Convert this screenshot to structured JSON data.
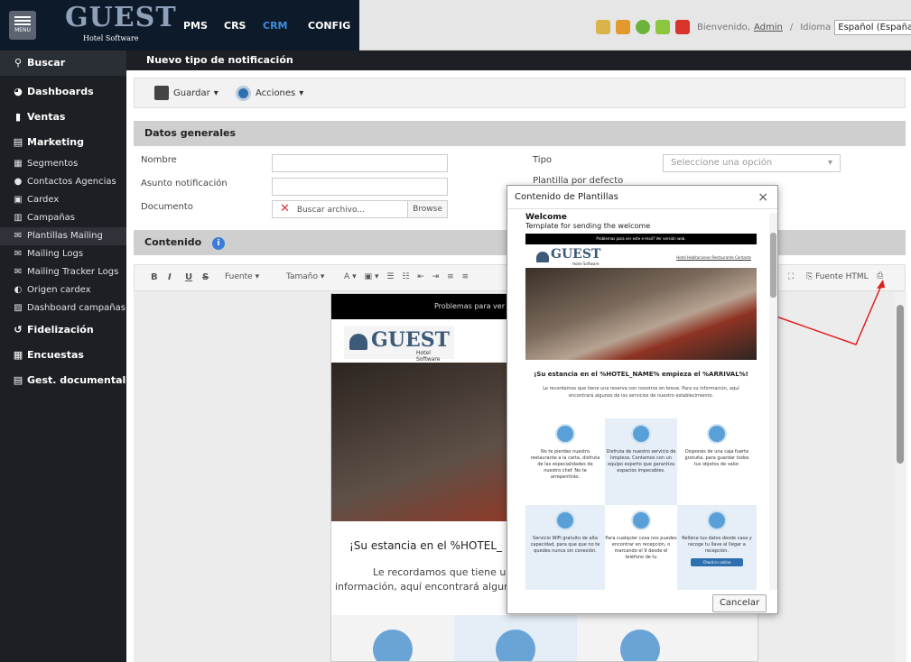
{
  "topbar": {
    "menu_label": "MENU",
    "logo": "GUEST",
    "logo_sub": "Hotel Software",
    "nav": [
      "PMS",
      "CRS",
      "CRM",
      "CONFIG"
    ],
    "welcome": "Bienvenido,",
    "user": "Admin",
    "separator": "/",
    "language_label": "Idioma",
    "language_value": "Español (España)"
  },
  "sidebar": {
    "search": "Buscar",
    "main": [
      {
        "label": "Dashboards",
        "icon": "pie-icon"
      },
      {
        "label": "Ventas",
        "icon": "building-icon"
      },
      {
        "label": "Marketing",
        "icon": "store-icon"
      }
    ],
    "marketing_items": [
      {
        "label": "Segmentos"
      },
      {
        "label": "Contactos Agencias"
      },
      {
        "label": "Cardex"
      },
      {
        "label": "Campañas"
      },
      {
        "label": "Plantillas Mailing"
      },
      {
        "label": "Mailing Logs"
      },
      {
        "label": "Mailing Tracker Logs"
      },
      {
        "label": "Origen cardex"
      },
      {
        "label": "Dashboard campañas"
      }
    ],
    "bottom": [
      {
        "label": "Fidelización"
      },
      {
        "label": "Encuestas"
      },
      {
        "label": "Gest. documental"
      }
    ]
  },
  "page": {
    "title": "Nuevo tipo de notificación",
    "toolbar": {
      "save": "Guardar",
      "actions": "Acciones"
    },
    "general_section": "Datos generales",
    "fields": {
      "nombre": "Nombre",
      "asunto": "Asunto notificación",
      "documento": "Documento",
      "doc_placeholder": "Buscar archivo...",
      "browse": "Browse",
      "tipo": "Tipo",
      "tipo_placeholder": "Seleccione una opción",
      "plantilla": "Plantilla por defecto"
    },
    "content_section": "Contenido",
    "editor": {
      "font": "Fuente",
      "size": "Tamaño",
      "html_source": "Fuente HTML"
    },
    "doc_preview": {
      "banner": "Problemas para ver e",
      "logo": "GUEST",
      "logo_sub": "Hotel Software",
      "heading": "¡Su estancia en el %HOTEL_",
      "body1": "Le recordamos que tiene una re",
      "body2": "información, aquí encontrará algunos"
    }
  },
  "modal": {
    "title": "Contenido de Plantillas",
    "close": "×",
    "cancel": "Cancelar",
    "tpl_title": "Welcome",
    "tpl_desc": "Template for sending the welcome",
    "banner": "Problemas para ver este e-mail? Ver versión web.",
    "logo": "GUEST",
    "logo_sub": "Hotel Software",
    "links": "Hotel  Habitaciones  Restaurante  Contacto",
    "heading": "¡Su estancia en el %HOTEL_NAME% empieza el %ARRIVAL%!",
    "intro": "Le recordamos que tiene una reserva con nosotros en breve. Para su información, aquí encontrará algunos de los servicios de nuestro establecimiento.",
    "features": [
      "No te pierdas nuestro restaurante a la carta, disfruta de las especialidades de nuestro chef. No te arrepentirás.",
      "Disfruta de nuestro servicio de limpieza. Contamos con un equipo experto que garantiza espacios impecables.",
      "Disponés de una caja fuerte gratuita, para guardar todos tus objetos de valor.",
      "Servicio WiFi gratuito de alta capacidad, para que que no te quedes nunca sin conexión.",
      "Para cualquier cosa nos puedes encontrar en recepción, o marcando el 9 desde el teléfono de tu",
      "Rellena tus datos desde casa y recoge tu llave al llegar a recepción."
    ],
    "checkin": "Check-in online"
  }
}
